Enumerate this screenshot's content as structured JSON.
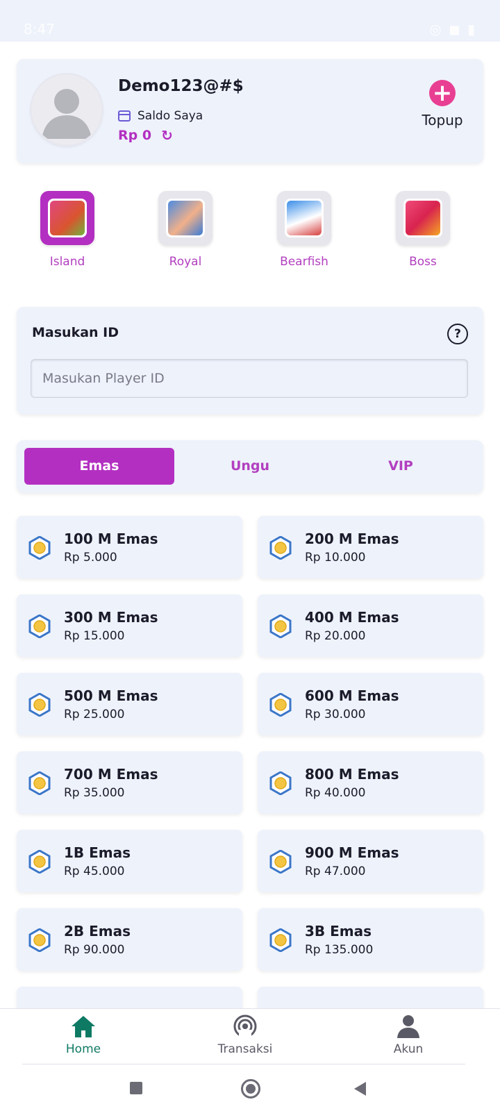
{
  "status_bar": {
    "time": "8:47",
    "icons": "◎ ◼ ▮"
  },
  "profile": {
    "username": "Demo123@#$",
    "saldo_label": "Saldo Saya",
    "balance": "Rp 0",
    "topup_label": "Topup"
  },
  "games": [
    {
      "label": "Island",
      "active": true,
      "color": "#d9552f"
    },
    {
      "label": "Royal",
      "active": false,
      "color": "#3a7bd6"
    },
    {
      "label": "Bearfish",
      "active": false,
      "color": "#3b8ee8"
    },
    {
      "label": "Boss",
      "active": false,
      "color": "#d8234f"
    }
  ],
  "id_section": {
    "title": "Masukan ID",
    "placeholder": "Masukan Player ID"
  },
  "tabs": [
    "Emas",
    "Ungu",
    "VIP"
  ],
  "items": [
    {
      "name": "100 M Emas",
      "price": "Rp 5.000"
    },
    {
      "name": "200 M Emas",
      "price": "Rp 10.000"
    },
    {
      "name": "300 M Emas",
      "price": "Rp 15.000"
    },
    {
      "name": "400 M Emas",
      "price": "Rp 20.000"
    },
    {
      "name": "500 M Emas",
      "price": "Rp 25.000"
    },
    {
      "name": "600 M Emas",
      "price": "Rp 30.000"
    },
    {
      "name": "700 M Emas",
      "price": "Rp 35.000"
    },
    {
      "name": "800 M Emas",
      "price": "Rp 40.000"
    },
    {
      "name": "1B Emas",
      "price": "Rp 45.000"
    },
    {
      "name": "900 M Emas",
      "price": "Rp 47.000"
    },
    {
      "name": "2B Emas",
      "price": "Rp 90.000"
    },
    {
      "name": "3B Emas",
      "price": "Rp 135.000"
    }
  ],
  "bottom_nav": [
    {
      "label": "Home",
      "icon": "home-icon",
      "active": true
    },
    {
      "label": "Transaksi",
      "icon": "broadcast-icon",
      "active": false
    },
    {
      "label": "Akun",
      "icon": "person-icon",
      "active": false
    }
  ],
  "colors": {
    "accent": "#b32fc1",
    "topup": "#e83f93",
    "home_active": "#0f7a64",
    "card_bg": "#eef2fb"
  }
}
